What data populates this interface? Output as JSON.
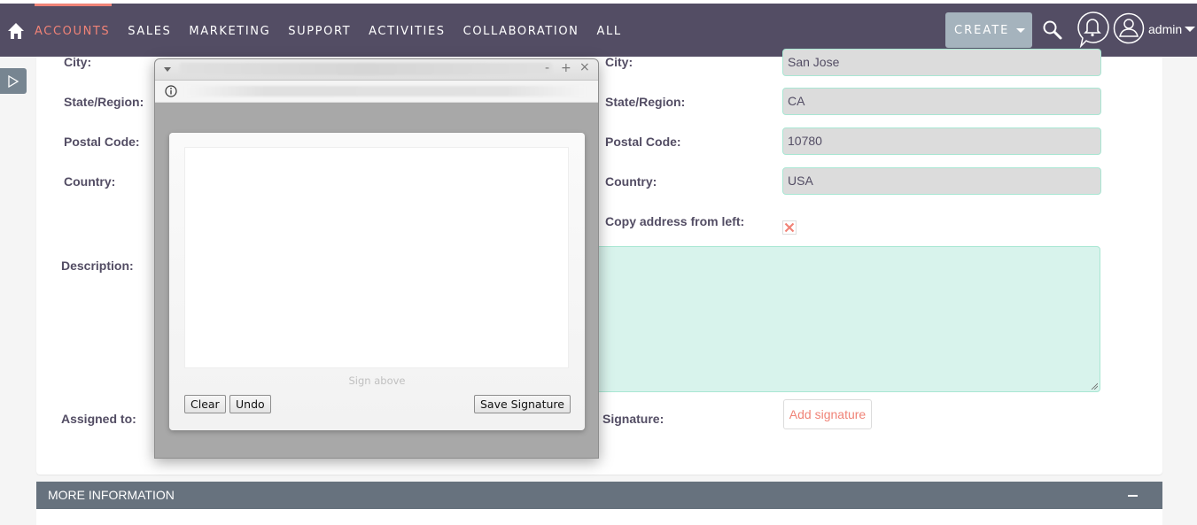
{
  "nav": {
    "items": [
      {
        "label": "ACCOUNTS",
        "active": true
      },
      {
        "label": "SALES",
        "active": false
      },
      {
        "label": "MARKETING",
        "active": false
      },
      {
        "label": "SUPPORT",
        "active": false
      },
      {
        "label": "ACTIVITIES",
        "active": false
      },
      {
        "label": "COLLABORATION",
        "active": false
      },
      {
        "label": "ALL",
        "active": false
      }
    ],
    "create_label": "CREATE",
    "user_label": "admin",
    "icons": {
      "home": "home-icon",
      "search": "search-icon",
      "notifications": "bell-icon",
      "user": "user-avatar-icon"
    }
  },
  "form": {
    "left_labels": {
      "city": "City:",
      "state": "State/Region:",
      "postal": "Postal Code:",
      "country": "Country:",
      "description": "Description:",
      "assigned": "Assigned to:"
    },
    "right": {
      "city_label": "City:",
      "city_value": "San Jose",
      "state_label": "State/Region:",
      "state_value": "CA",
      "postal_label": "Postal Code:",
      "postal_value": "10780",
      "country_label": "Country:",
      "country_value": "USA",
      "copy_label": "Copy address from left:",
      "copy_checked": false,
      "signature_label": "Signature:",
      "add_signature_label": "Add signature"
    }
  },
  "more_info": {
    "title": "MORE INFORMATION",
    "collapse_symbol": "−"
  },
  "popup": {
    "controls": {
      "minimize": "-",
      "maximize": "+",
      "close": "×"
    },
    "signature_hint": "Sign above",
    "buttons": {
      "clear": "Clear",
      "undo": "Undo",
      "save": "Save Signature"
    }
  },
  "colors": {
    "nav_bg": "#534d64",
    "accent": "#f08377",
    "field_border": "#a9e7d3",
    "section_header": "#67727e"
  }
}
